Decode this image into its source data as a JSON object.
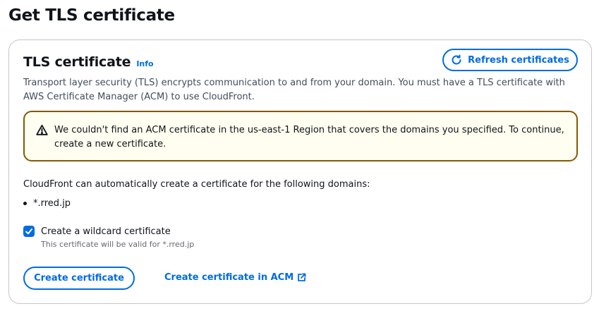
{
  "page": {
    "title": "Get TLS certificate"
  },
  "panel": {
    "title": "TLS certificate",
    "info_label": "Info",
    "refresh_label": "Refresh certificates",
    "description": "Transport layer security (TLS) encrypts communication to and from your domain. You must have a TLS certificate with AWS Certificate Manager (ACM) to use CloudFront.",
    "alert": {
      "type": "warning",
      "icon": "warning-icon",
      "message": "We couldn't find an ACM certificate in the us-east-1 Region that covers the domains you specified. To continue, create a new certificate."
    },
    "auto_create_text": "CloudFront can automatically create a certificate for the following domains:",
    "domains": [
      "*.rred.jp"
    ],
    "wildcard": {
      "checked": true,
      "label": "Create a wildcard certificate",
      "description": "This certificate will be valid for *.rred.jp"
    },
    "create_button_label": "Create certificate",
    "acm_link_label": "Create certificate in ACM",
    "acm_link_icon": "external-link-icon"
  },
  "colors": {
    "accent": "#006ce0",
    "warning_border": "#855900",
    "warning_background": "#fffef0"
  }
}
